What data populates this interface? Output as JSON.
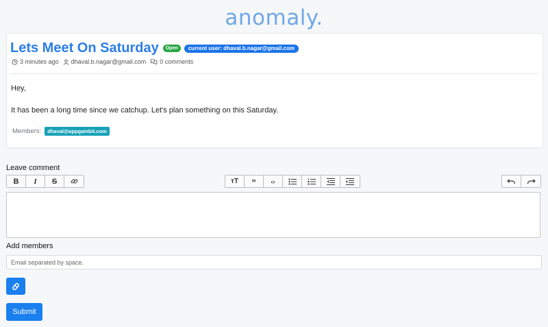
{
  "header": {
    "logo_text": "anomaly."
  },
  "post": {
    "title": "Lets Meet On Saturday",
    "status_badge": "Open",
    "current_user_badge": "current user: dhaval.b.nagar@gmail.com",
    "meta": {
      "time": "3 minutes ago",
      "author": "dhaval.b.nagar@gmail.com",
      "comments": "0 comments"
    },
    "body": [
      "Hey,",
      "It has been a long time since we catchup. Let's plan something on this Saturday."
    ],
    "members_label": "Members:",
    "members": [
      "dhaval@appgambit.com"
    ]
  },
  "comment": {
    "label": "Leave comment",
    "toolbar": {
      "format": [
        "bold-icon",
        "italic-icon",
        "strikethrough-icon",
        "link-icon"
      ],
      "blocks": [
        "heading-icon",
        "quote-icon",
        "code-icon",
        "unordered-list-icon",
        "ordered-list-icon",
        "outdent-icon",
        "indent-icon"
      ],
      "history": [
        "undo-icon",
        "redo-icon"
      ]
    },
    "value": ""
  },
  "add_members": {
    "label": "Add members",
    "placeholder": "Email separated by space.",
    "value": ""
  },
  "actions": {
    "attach_icon": "paperclip-icon",
    "submit_label": "Submit"
  },
  "colors": {
    "accent": "#1a7fef",
    "title": "#2b7de9",
    "logo": "#6fa8e6",
    "open_badge": "#28a745",
    "member_badge": "#17a2b8"
  }
}
